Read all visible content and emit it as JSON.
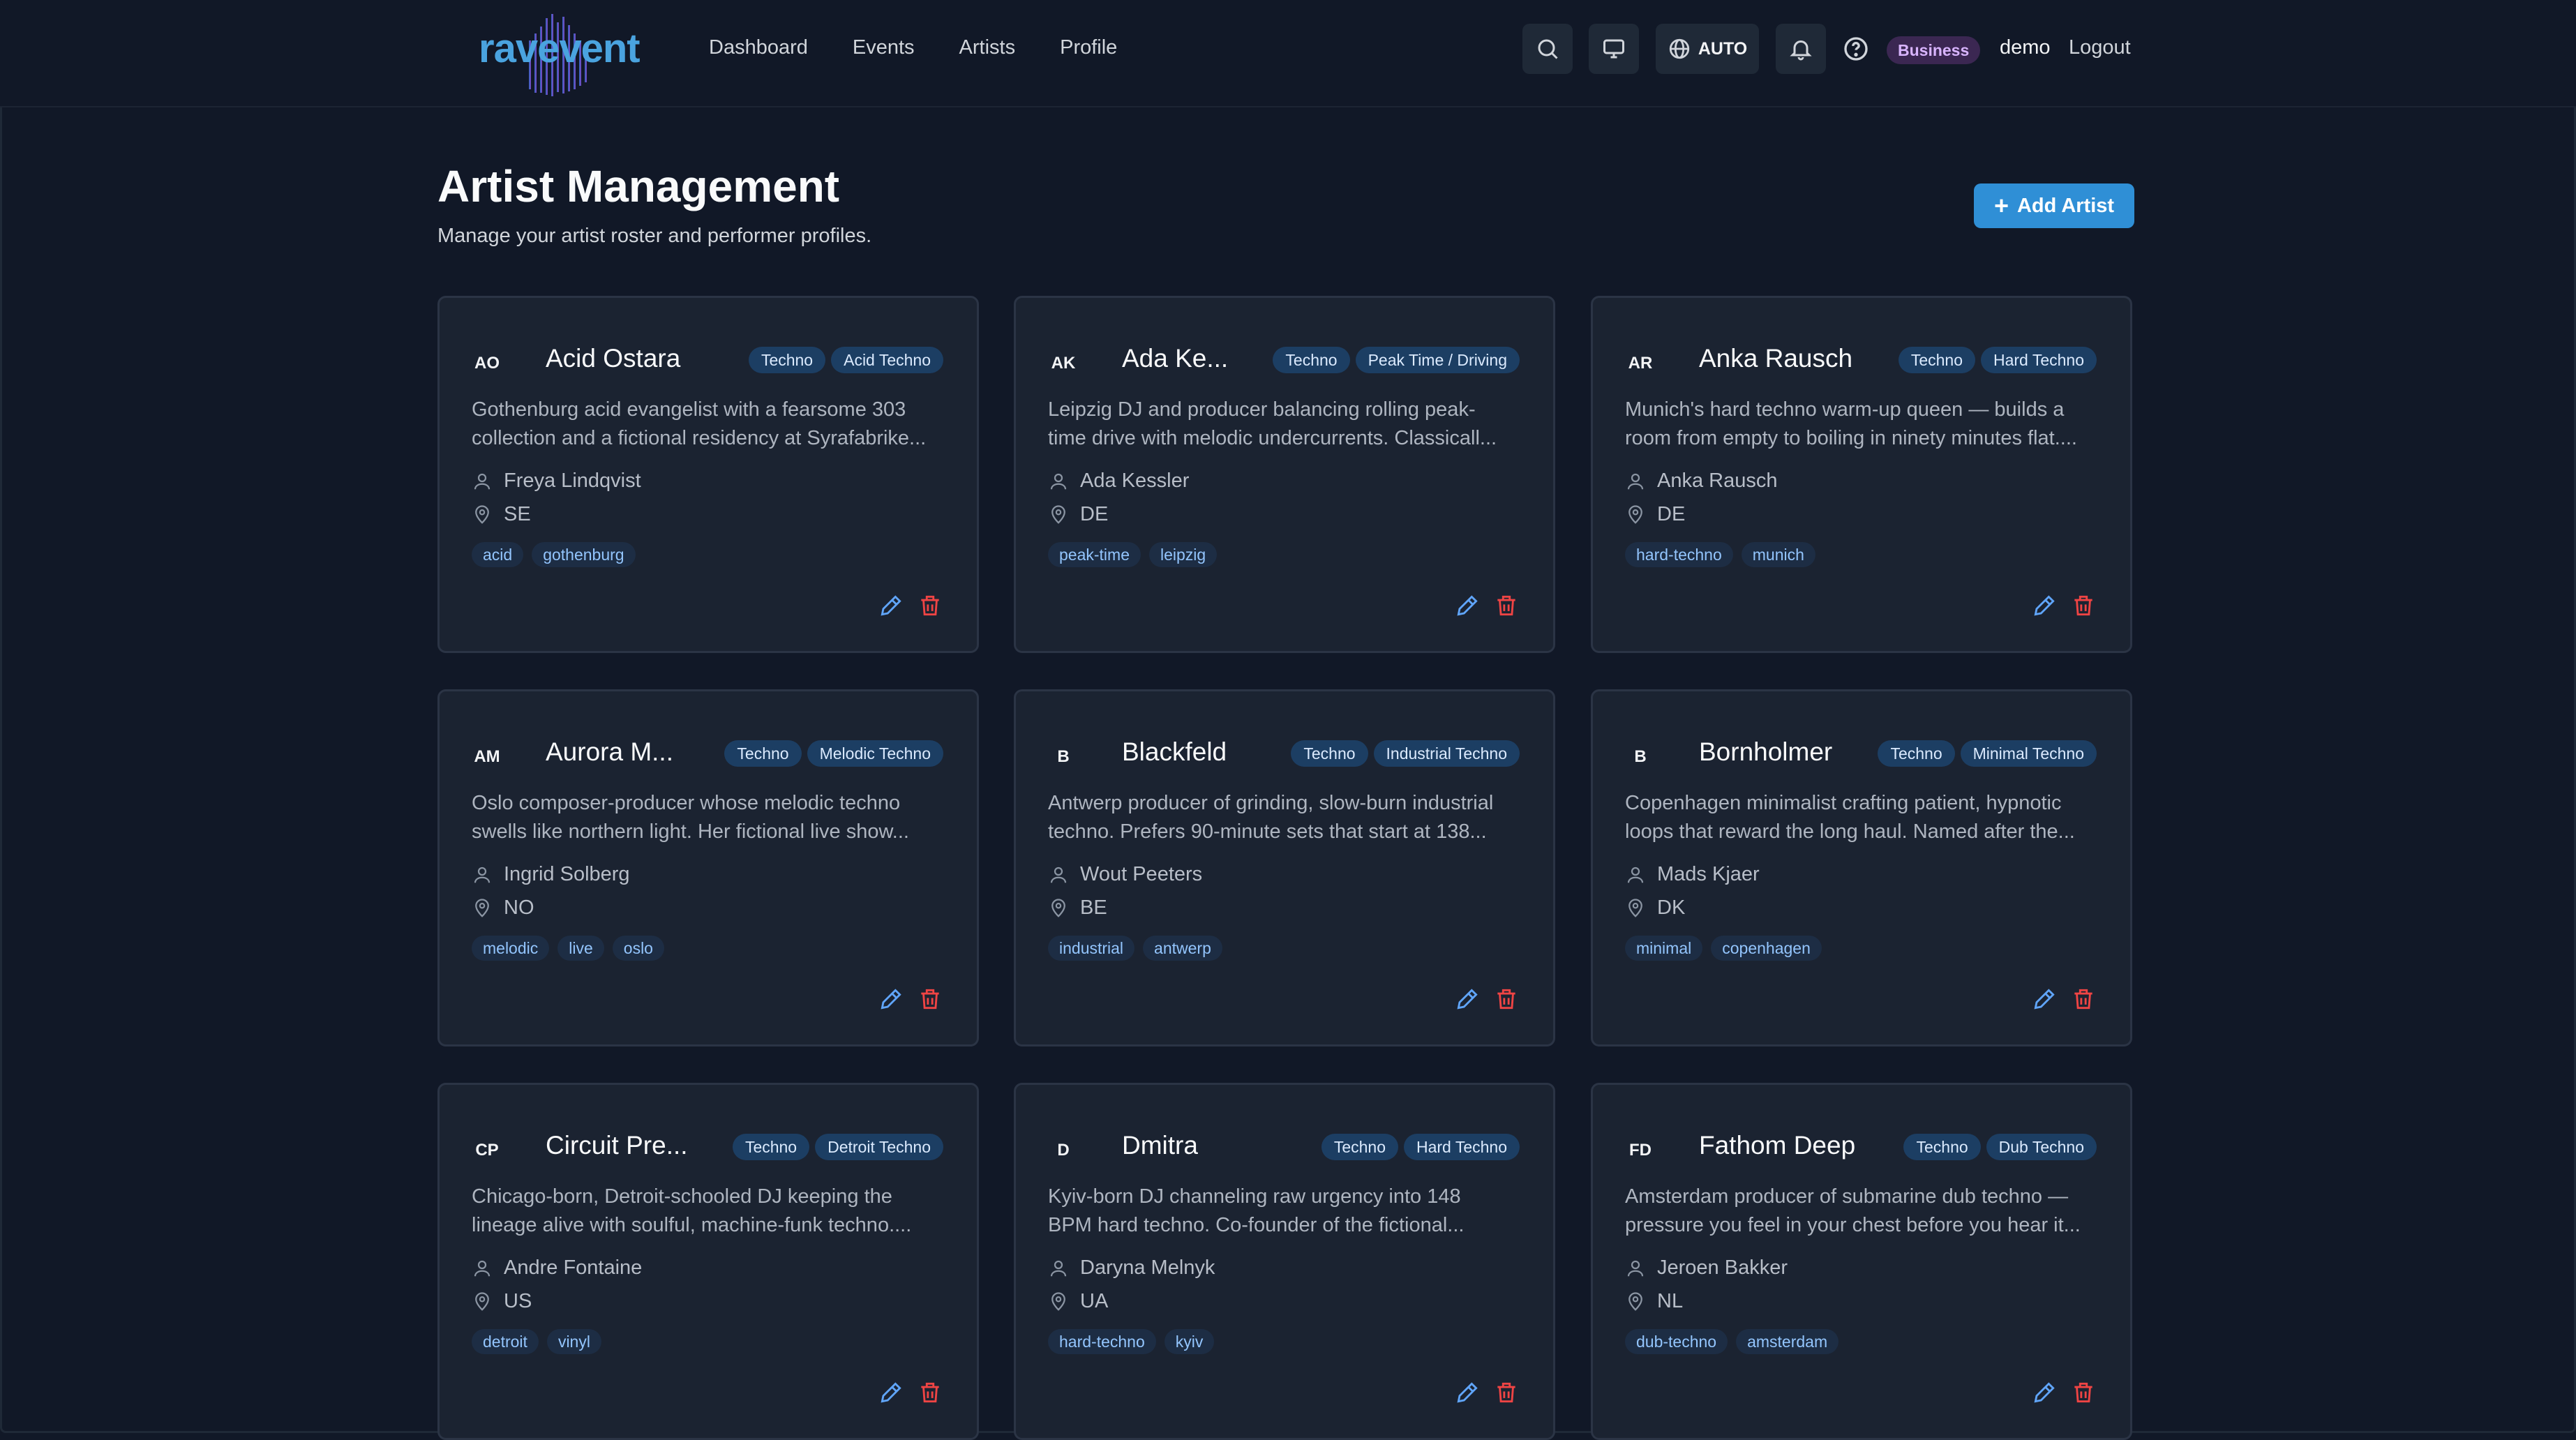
{
  "app": {
    "logo": "ravevent"
  },
  "nav": {
    "dashboard": "Dashboard",
    "events": "Events",
    "artists": "Artists",
    "profile": "Profile"
  },
  "header": {
    "auto_label": "AUTO",
    "plan_badge": "Business",
    "username": "demo",
    "logout": "Logout"
  },
  "page": {
    "title": "Artist Management",
    "subtitle": "Manage your artist roster and performer profiles.",
    "add_button": "Add Artist"
  },
  "cards": [
    {
      "initials": "AO",
      "name": "Acid Ostara",
      "genre": "Techno",
      "subgenre": "Acid Techno",
      "desc_line1": "Gothenburg acid evangelist with a fearsome 303",
      "desc_line2": "collection and a fictional residency at Syrafabrike...",
      "person": "Freya Lindqvist",
      "country": "SE",
      "tags": [
        "acid",
        "gothenburg"
      ]
    },
    {
      "initials": "AK",
      "name": "Ada Ke...",
      "genre": "Techno",
      "subgenre": "Peak Time / Driving",
      "desc_line1": "Leipzig DJ and producer balancing rolling peak-",
      "desc_line2": "time drive with melodic undercurrents. Classicall...",
      "person": "Ada Kessler",
      "country": "DE",
      "tags": [
        "peak-time",
        "leipzig"
      ]
    },
    {
      "initials": "AR",
      "name": "Anka Rausch",
      "genre": "Techno",
      "subgenre": "Hard Techno",
      "desc_line1": "Munich's hard techno warm-up queen — builds a",
      "desc_line2": "room from empty to boiling in ninety minutes flat....",
      "person": "Anka Rausch",
      "country": "DE",
      "tags": [
        "hard-techno",
        "munich"
      ]
    },
    {
      "initials": "AM",
      "name": "Aurora M...",
      "genre": "Techno",
      "subgenre": "Melodic Techno",
      "desc_line1": "Oslo composer-producer whose melodic techno",
      "desc_line2": "swells like northern light. Her fictional live show...",
      "person": "Ingrid Solberg",
      "country": "NO",
      "tags": [
        "melodic",
        "live",
        "oslo"
      ]
    },
    {
      "initials": "B",
      "name": "Blackfeld",
      "genre": "Techno",
      "subgenre": "Industrial Techno",
      "desc_line1": "Antwerp producer of grinding, slow-burn industrial",
      "desc_line2": "techno. Prefers 90-minute sets that start at 138...",
      "person": "Wout Peeters",
      "country": "BE",
      "tags": [
        "industrial",
        "antwerp"
      ]
    },
    {
      "initials": "B",
      "name": "Bornholmer",
      "genre": "Techno",
      "subgenre": "Minimal Techno",
      "desc_line1": "Copenhagen minimalist crafting patient, hypnotic",
      "desc_line2": "loops that reward the long haul. Named after the...",
      "person": "Mads Kjaer",
      "country": "DK",
      "tags": [
        "minimal",
        "copenhagen"
      ]
    },
    {
      "initials": "CP",
      "name": "Circuit Pre...",
      "genre": "Techno",
      "subgenre": "Detroit Techno",
      "desc_line1": "Chicago-born, Detroit-schooled DJ keeping the",
      "desc_line2": "lineage alive with soulful, machine-funk techno....",
      "person": "Andre Fontaine",
      "country": "US",
      "tags": [
        "detroit",
        "vinyl"
      ]
    },
    {
      "initials": "D",
      "name": "Dmitra",
      "genre": "Techno",
      "subgenre": "Hard Techno",
      "desc_line1": "Kyiv-born DJ channeling raw urgency into 148",
      "desc_line2": "BPM hard techno. Co-founder of the fictional...",
      "person": "Daryna Melnyk",
      "country": "UA",
      "tags": [
        "hard-techno",
        "kyiv"
      ]
    },
    {
      "initials": "FD",
      "name": "Fathom Deep",
      "genre": "Techno",
      "subgenre": "Dub Techno",
      "desc_line1": "Amsterdam producer of submarine dub techno —",
      "desc_line2": "pressure you feel in your chest before you hear it...",
      "person": "Jeroen Bakker",
      "country": "NL",
      "tags": [
        "dub-techno",
        "amsterdam"
      ]
    }
  ]
}
